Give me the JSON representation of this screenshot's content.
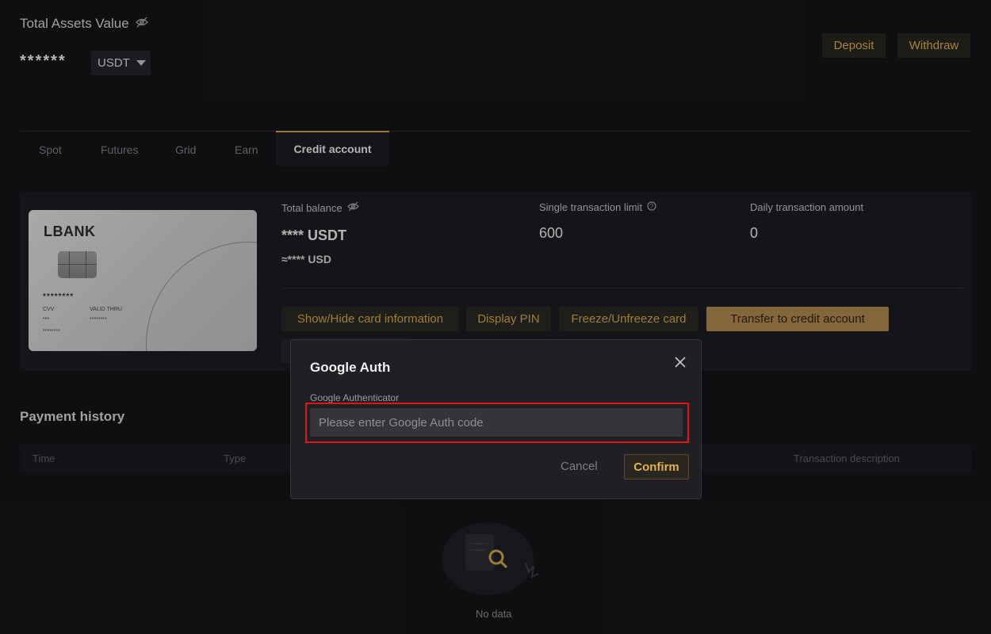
{
  "header": {
    "assets_title": "Total Assets Value",
    "assets_value": "******",
    "currency": "USDT",
    "deposit_label": "Deposit",
    "withdraw_label": "Withdraw"
  },
  "tabs": [
    {
      "label": "Spot"
    },
    {
      "label": "Futures"
    },
    {
      "label": "Grid"
    },
    {
      "label": "Earn"
    },
    {
      "label": "Credit account",
      "active": true
    }
  ],
  "card": {
    "brand": "LBANK",
    "number_masked": "********",
    "cvv_label": "CVV",
    "cvv_value": "***",
    "valid_thru_label": "VALID THRU",
    "valid_thru_value": "********",
    "holder_masked": "********"
  },
  "account": {
    "total_balance_label": "Total balance",
    "total_balance_usdt": "**** USDT",
    "total_balance_usd": "≈**** USD",
    "single_limit_label": "Single transaction limit",
    "single_limit_value": "600",
    "daily_amount_label": "Daily transaction amount",
    "daily_amount_value": "0"
  },
  "actions": {
    "show_hide": "Show/Hide card information",
    "display_pin": "Display PIN",
    "freeze": "Freeze/Unfreeze card",
    "transfer": "Transfer to credit account"
  },
  "payment_history": {
    "title": "Payment history",
    "columns": [
      "Time",
      "Type",
      "Transaction description"
    ],
    "empty_text": "No data"
  },
  "modal": {
    "title": "Google Auth",
    "field_label": "Google Authenticator",
    "placeholder": "Please enter Google Auth code",
    "value": "",
    "cancel_label": "Cancel",
    "confirm_label": "Confirm"
  },
  "colors": {
    "accent": "#c9a24a",
    "highlight_border": "#e01616",
    "background": "#141418"
  }
}
